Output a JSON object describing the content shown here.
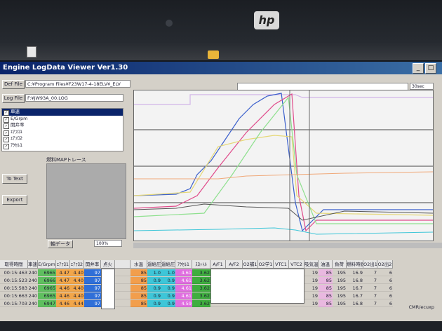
{
  "app": {
    "title": "Engine LogData Viewer Ver1.30",
    "def_file_label": "Def File",
    "def_file_path": "C:¥Program Files¥F23W17-4-18ELV¥_ELV",
    "log_file_label": "Log File",
    "log_file_path": "F:¥JW93A_00.LOG",
    "time_span": "30sec",
    "map_title": "燃料MAPトレース",
    "to_text_label": "To Text",
    "export_label": "Export",
    "map_data_label": "軸データ",
    "zoom": "100%",
    "window_buttons": [
      "_",
      "□"
    ],
    "footer_note": "CMR/ecuxp"
  },
  "channels": [
    "車速",
    "E/Grpm",
    "開弁率",
    "ｴｱﾌﾛ1",
    "ｴｱﾌﾛ2",
    "ｱｸｾﾙ1"
  ],
  "table": {
    "headers": [
      "取得時間",
      "車速",
      "E/Grpm",
      "ｴｱﾌﾛ1",
      "ｴｱﾌﾛ2",
      "開弁率",
      "点火",
      "",
      "水温",
      "過給圧",
      "過給圧",
      "ｱｸｾﾙ1",
      "ｽﾛｯﾄﾙ",
      "A/F1",
      "A/F2",
      "O2補1",
      "O2学1",
      "VTC1",
      "VTC2",
      "吸気温",
      "油温",
      "負荷",
      "燃料時間",
      "O2出1",
      "O2出2"
    ],
    "rows": [
      [
        "00:15:463",
        "240",
        "6965",
        "4.47",
        "4.40",
        "97",
        "",
        "",
        "85",
        "1.0",
        "1.0",
        "4.61",
        "3.62",
        "",
        "",
        "",
        "",
        "",
        "",
        "19",
        "85",
        "195",
        "16.9",
        "7",
        "6"
      ],
      [
        "00:15:523",
        "240",
        "6966",
        "4.47",
        "4.40",
        "97",
        "",
        "",
        "85",
        "0.9",
        "0.9",
        "4.61",
        "3.62",
        "",
        "",
        "",
        "",
        "",
        "",
        "19",
        "85",
        "195",
        "16.8",
        "7",
        "6"
      ],
      [
        "00:15:583",
        "240",
        "6965",
        "4.46",
        "4.40",
        "97",
        "",
        "",
        "85",
        "0.9",
        "0.9",
        "4.61",
        "3.62",
        "",
        "",
        "",
        "",
        "",
        "",
        "19",
        "85",
        "195",
        "16.7",
        "7",
        "6"
      ],
      [
        "00:15:663",
        "240",
        "6965",
        "4.46",
        "4.40",
        "97",
        "",
        "",
        "85",
        "0.9",
        "0.9",
        "4.61",
        "3.62",
        "",
        "",
        "",
        "",
        "",
        "",
        "19",
        "85",
        "195",
        "16.7",
        "7",
        "6"
      ],
      [
        "00:15:703",
        "240",
        "6947",
        "4.46",
        "4.44",
        "97",
        "",
        "",
        "85",
        "0.9",
        "0.9",
        "4.59",
        "3.62",
        "",
        "",
        "",
        "",
        "",
        "",
        "19",
        "85",
        "195",
        "16.8",
        "7",
        "6"
      ]
    ]
  },
  "colors": {
    "accent": "#0a246a",
    "rpm_col": "#5fbf5f",
    "af_col": "#f2a64a",
    "valve_col": "#2f6fd8",
    "water_col": "#f29e4c",
    "boost_col": "#3ec6d8",
    "accel_col": "#e06fe0",
    "throttle_col": "#3fae3f",
    "oiltemp_col": "#e9b8e0"
  }
}
